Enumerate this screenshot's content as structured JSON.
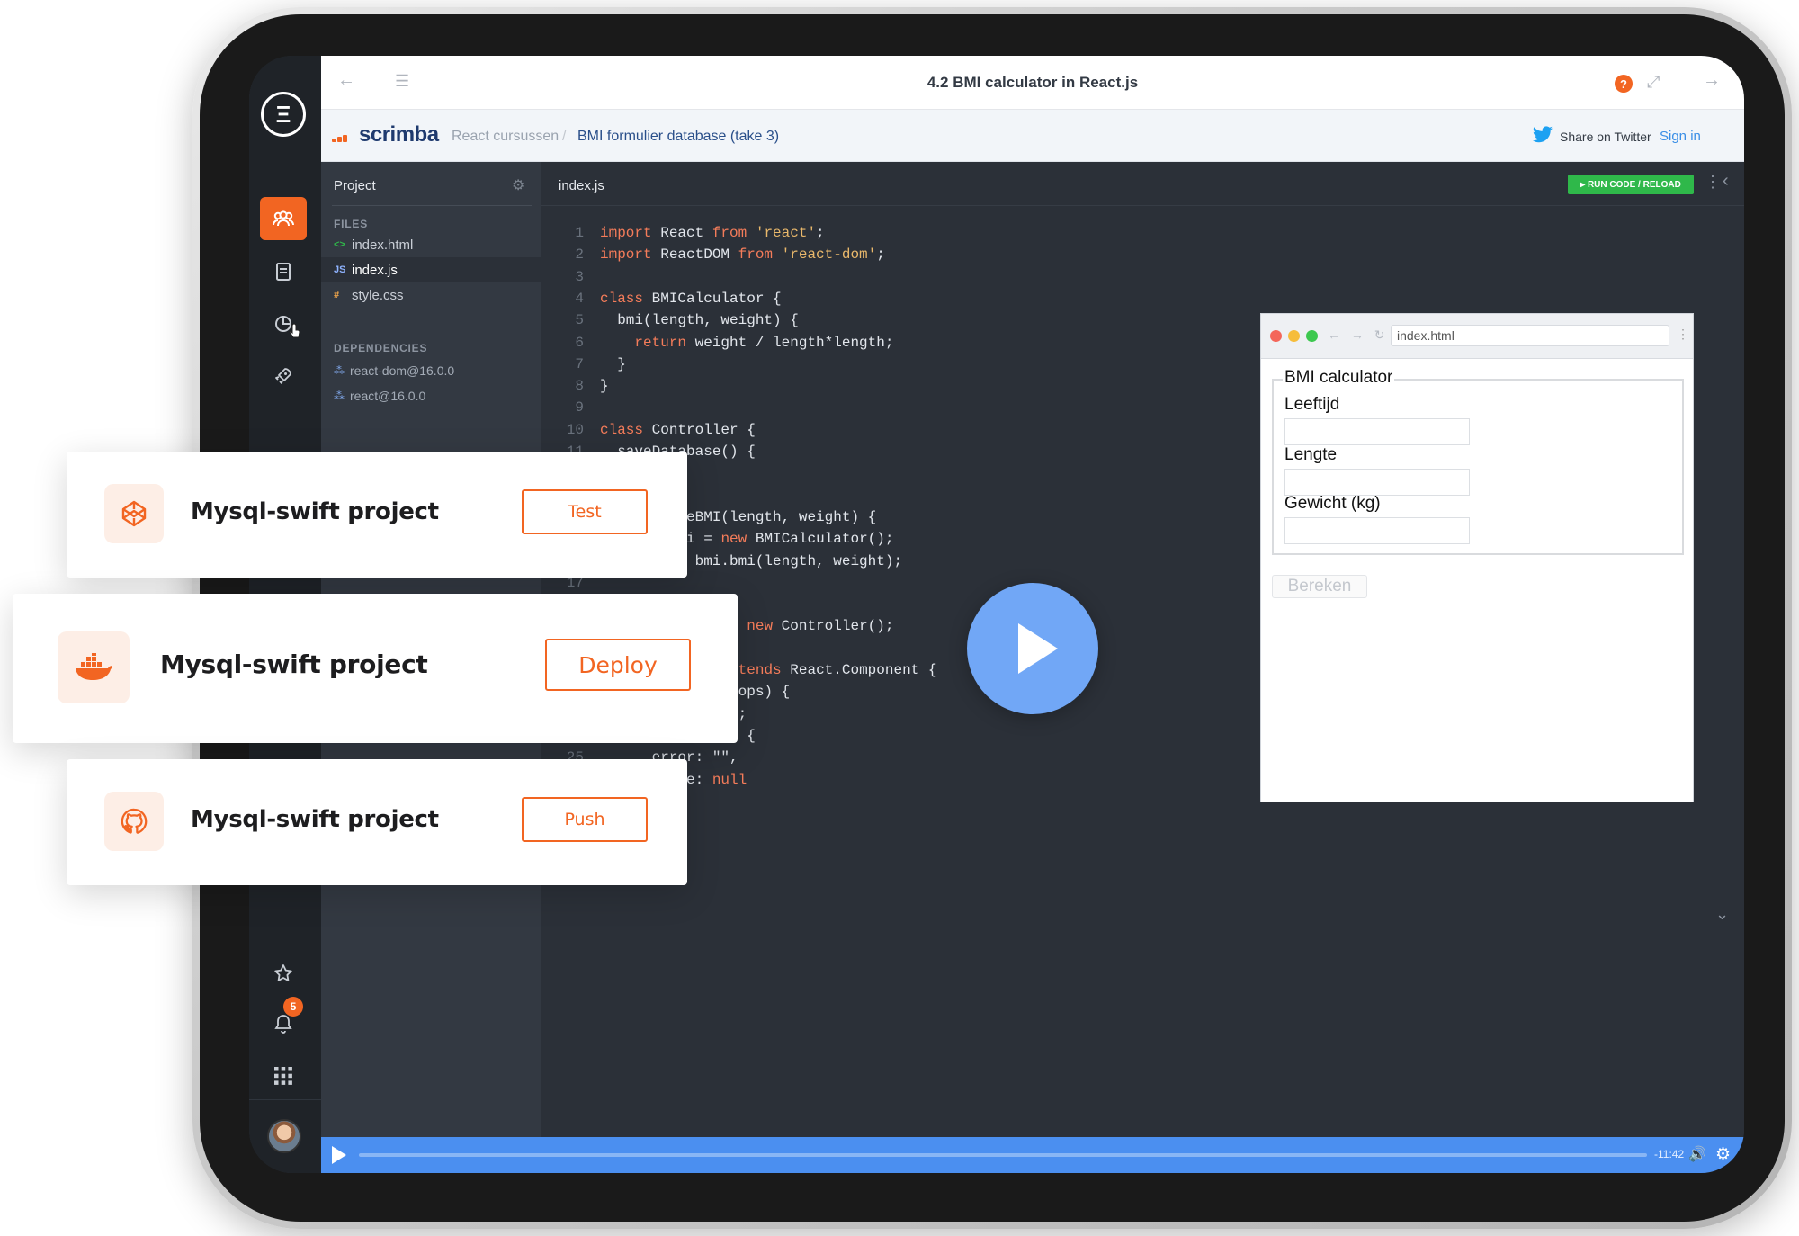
{
  "app": {
    "title": "4.2 BMI calculator in React.js",
    "logo_letter": "Ξ"
  },
  "breadcrumb": {
    "brand": "scrimba",
    "section": "React cursussen",
    "separator": "/",
    "page": "BMI formulier database (take 3)",
    "share_label": "Share on Twitter",
    "signin_label": "Sign in"
  },
  "sidebar": {
    "notification_count": "5"
  },
  "files_panel": {
    "title": "Project",
    "files_header": "FILES",
    "files": [
      {
        "ext": "<>",
        "name": "index.html",
        "color": "#2fb84a"
      },
      {
        "ext": "JS",
        "name": "index.js",
        "color": "#8fb3ff"
      },
      {
        "ext": "#",
        "name": "style.css",
        "color": "#f2a74b"
      }
    ],
    "deps_header": "DEPENDENCIES",
    "dependencies": [
      "react-dom@16.0.0",
      "react@16.0.0"
    ]
  },
  "editor": {
    "tab": "index.js",
    "run_label": "▸ RUN CODE / RELOAD",
    "lines": [
      {
        "n": "1",
        "parts": [
          [
            "kw",
            "import"
          ],
          [
            "t",
            " React "
          ],
          [
            "kw",
            "from"
          ],
          [
            "str",
            " 'react'"
          ],
          [
            "t",
            ";"
          ]
        ]
      },
      {
        "n": "2",
        "parts": [
          [
            "kw",
            "import"
          ],
          [
            "t",
            " ReactDOM "
          ],
          [
            "kw",
            "from"
          ],
          [
            "str",
            " 'react-dom'"
          ],
          [
            "t",
            ";"
          ]
        ]
      },
      {
        "n": "3",
        "parts": []
      },
      {
        "n": "4",
        "parts": [
          [
            "kw",
            "class"
          ],
          [
            "t",
            " BMICalculator {"
          ]
        ]
      },
      {
        "n": "5",
        "parts": [
          [
            "t",
            "  bmi(length, weight) {"
          ]
        ]
      },
      {
        "n": "6",
        "parts": [
          [
            "t",
            "    "
          ],
          [
            "kw",
            "return"
          ],
          [
            "t",
            " weight / length*length;"
          ]
        ]
      },
      {
        "n": "7",
        "parts": [
          [
            "t",
            "  }"
          ]
        ]
      },
      {
        "n": "8",
        "parts": [
          [
            "t",
            "}"
          ]
        ]
      },
      {
        "n": "9",
        "parts": []
      },
      {
        "n": "10",
        "parts": [
          [
            "kw",
            "class"
          ],
          [
            "t",
            " Controller {"
          ]
        ]
      },
      {
        "n": "11",
        "parts": [
          [
            "t",
            "  saveDatabase() {"
          ]
        ]
      },
      {
        "n": "12",
        "parts": []
      },
      {
        "n": "13",
        "parts": []
      },
      {
        "n": "14",
        "parts": [
          [
            "t",
            "  calculateBMI(length, weight) {"
          ]
        ]
      },
      {
        "n": "15",
        "parts": [
          [
            "t",
            "    "
          ],
          [
            "kw",
            "let"
          ],
          [
            "t",
            " bmi = "
          ],
          [
            "kw",
            "new"
          ],
          [
            "t",
            " BMICalculator();"
          ]
        ]
      },
      {
        "n": "16",
        "parts": [
          [
            "t",
            "    "
          ],
          [
            "kw",
            "return"
          ],
          [
            "t",
            " bmi.bmi(length, weight);"
          ]
        ]
      },
      {
        "n": "17",
        "parts": []
      },
      {
        "n": "18",
        "parts": []
      },
      {
        "n": "19",
        "parts": [
          [
            "kw",
            "let"
          ],
          [
            "t",
            " controller = "
          ],
          [
            "kw",
            "new"
          ],
          [
            "t",
            " Controller();"
          ]
        ]
      },
      {
        "n": "20",
        "parts": []
      },
      {
        "n": "21",
        "parts": [
          [
            "kw",
            "class"
          ],
          [
            "t",
            " BMIForm "
          ],
          [
            "kw",
            "extends"
          ],
          [
            "t",
            " React.Component {"
          ]
        ]
      },
      {
        "n": "22",
        "parts": [
          [
            "t",
            "  constructor(props) {"
          ]
        ]
      },
      {
        "n": "23",
        "parts": [
          [
            "t",
            "    super(props);"
          ]
        ]
      },
      {
        "n": "24",
        "parts": [
          [
            "t",
            "    this.state = {"
          ]
        ]
      },
      {
        "n": "25",
        "parts": [
          [
            "t",
            "      error: \"\","
          ]
        ]
      },
      {
        "n": "26",
        "parts": [
          [
            "t",
            "      value: "
          ],
          [
            "kw",
            "null"
          ]
        ]
      }
    ]
  },
  "preview": {
    "url": "index.html",
    "legend": "BMI calculator",
    "fields": [
      "Leeftijd",
      "Lengte",
      "Gewicht (kg)"
    ],
    "submit": "Bereken"
  },
  "player": {
    "time_remaining": "-11:42"
  },
  "cards": [
    {
      "icon": "codepen-icon",
      "title": "Mysql-swift project",
      "button": "Test"
    },
    {
      "icon": "docker-icon",
      "title": "Mysql-swift project",
      "button": "Deploy"
    },
    {
      "icon": "github-icon",
      "title": "Mysql-swift project",
      "button": "Push"
    }
  ],
  "colors": {
    "accent": "#f26522",
    "run_green": "#2fb84a",
    "play_blue": "#71a7f6",
    "video_bar": "#4b8ff0"
  }
}
